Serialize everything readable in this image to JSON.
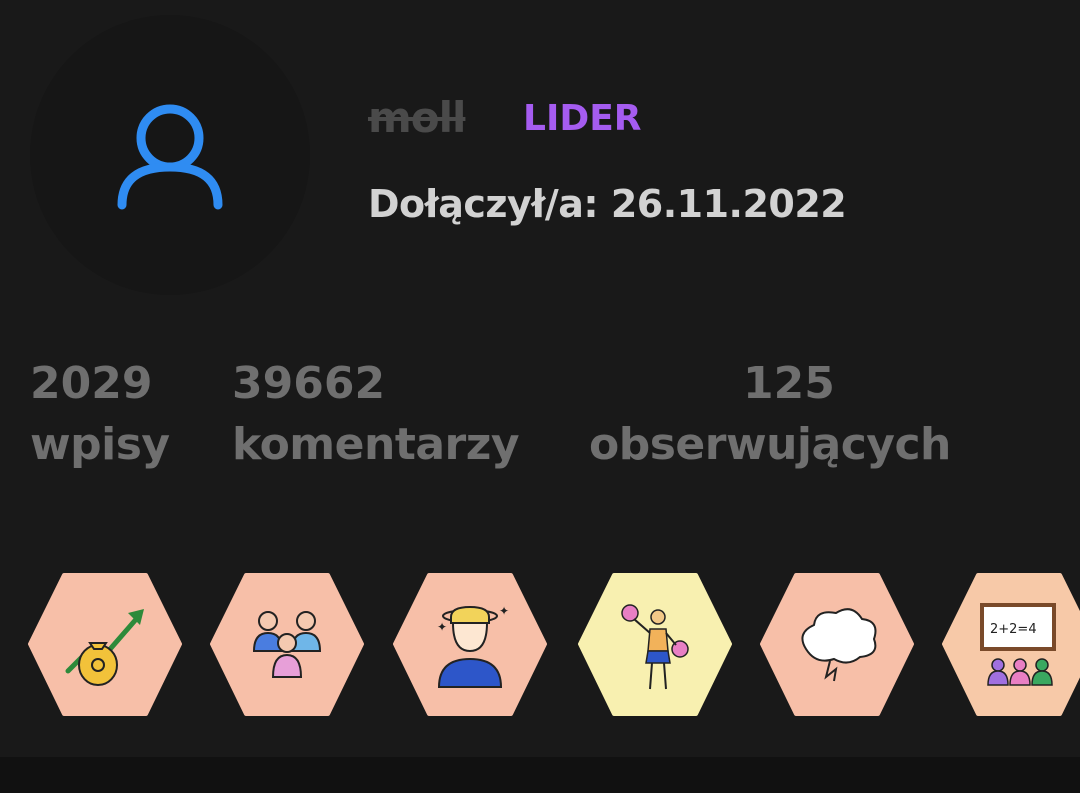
{
  "profile": {
    "username": "moll",
    "rank": "LIDER",
    "joined_label": "Dołączył/a: 26.11.2022",
    "avatar_icon": "user-outline-icon"
  },
  "stats": [
    {
      "value": "2029",
      "label": "wpisy"
    },
    {
      "value": "39662",
      "label": "komentarzy"
    },
    {
      "value": "125",
      "label": "obserwujących"
    }
  ],
  "colors": {
    "rank": "#a55cf0",
    "avatar_icon": "#2f8cf2",
    "stat_text": "#6f6f6f",
    "badge_peach": "#f7bfa8",
    "badge_yellow": "#f8f0b0",
    "background": "#191919"
  },
  "badges": [
    {
      "icon": "money-bag-growth-icon",
      "color": "peach"
    },
    {
      "icon": "group-of-people-icon",
      "color": "peach"
    },
    {
      "icon": "dizzy-student-icon",
      "color": "peach"
    },
    {
      "icon": "cheerleader-icon",
      "color": "yellow"
    },
    {
      "icon": "thought-cloud-icon",
      "color": "peach"
    },
    {
      "icon": "classroom-blackboard-icon",
      "color": "peach"
    }
  ],
  "badge_blackboard_text": "2+2=4"
}
